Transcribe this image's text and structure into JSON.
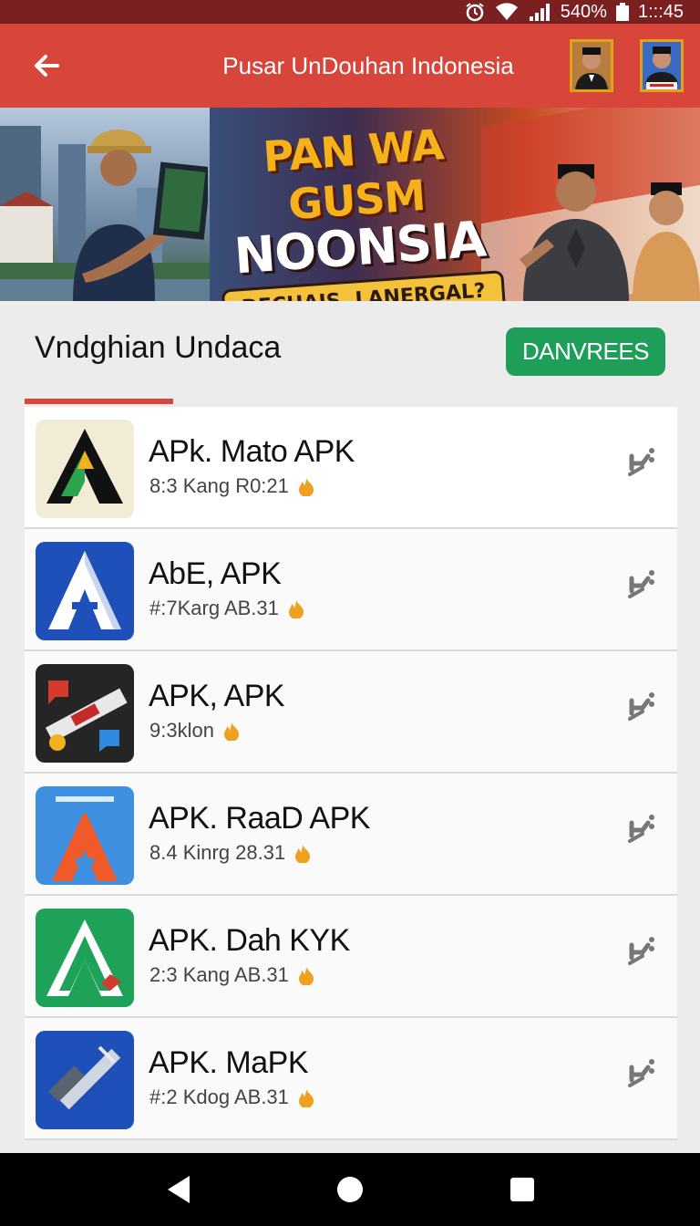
{
  "status_bar": {
    "battery": "540%",
    "time": "1:::45"
  },
  "app_bar": {
    "title": "Pusar UnDouhan Indonesia"
  },
  "banner": {
    "line1": "PAN WA GUSM",
    "line2": "NOONSIA",
    "line3": "DECHAIS, LANERGAL?"
  },
  "section": {
    "title": "Vndghian Undaca",
    "download_label": "DANVREES"
  },
  "apps": [
    {
      "name": "APk. Mato APK",
      "meta": "8:3 Kang R0:21",
      "icon": "black-green-a-icon"
    },
    {
      "name": "AbE, APK",
      "meta": "#:7Karg AB.31",
      "icon": "blue-white-a-icon"
    },
    {
      "name": "APK, APK",
      "meta": "9:3klon",
      "icon": "tools-a-icon"
    },
    {
      "name": "APK. RaaD APK",
      "meta": "8.4 Kinrg 28.31",
      "icon": "orange-a-icon"
    },
    {
      "name": "APK. Dah KYK",
      "meta": "2:3 Kang AB.31",
      "icon": "green-a-icon"
    },
    {
      "name": "APK. MaPK",
      "meta": "#:2 Kdog AB.31",
      "icon": "blue-tool-icon"
    }
  ],
  "colors": {
    "primary": "#d8453a",
    "accent": "#1e9e58"
  }
}
